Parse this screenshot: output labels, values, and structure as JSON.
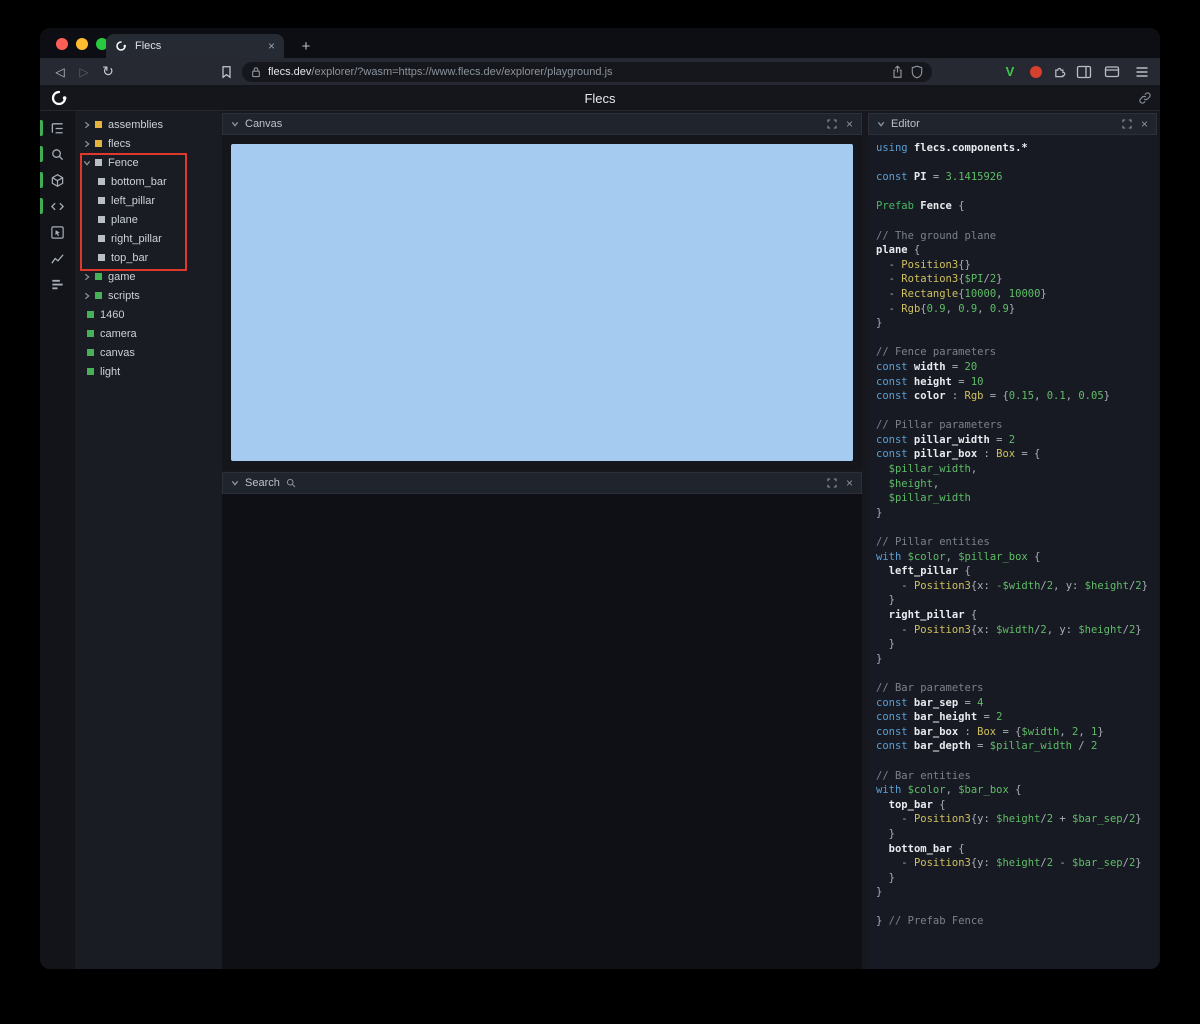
{
  "colors": {
    "canvas_surface": "#a6cbf0",
    "accent_green": "#3fae54",
    "annotation_red": "#e0382c",
    "module_yellow": "#e4b33e",
    "entity_green": "#47b158",
    "prefab_gray": "#b8bfc7",
    "traffic_red": "#ff5f57",
    "traffic_yellow": "#febc2e",
    "traffic_green": "#28c840",
    "code": {
      "keyword": "#5a9fd4",
      "definition": "#45b863",
      "type": "#cfc05e",
      "number": "#5fbd68",
      "variable": "#5fbd68",
      "comment": "#7b818b",
      "identifier": "#e8ebef",
      "plain": "#a9afb8"
    }
  },
  "glyphs": {
    "close": "×",
    "plus": "+",
    "back": "◁",
    "forward": "▷",
    "reload": "↻",
    "v_badge": "V"
  },
  "browser": {
    "tab_title": "Flecs",
    "url_domain": "flecs.dev",
    "url_rest": "/explorer/?wasm=https://www.flecs.dev/explorer/playground.js"
  },
  "header": {
    "title": "Flecs"
  },
  "rail": {
    "icons": [
      {
        "name": "entity-tree-icon",
        "active": true
      },
      {
        "name": "query-search-icon",
        "active": true
      },
      {
        "name": "scene-cube-icon",
        "active": true
      },
      {
        "name": "code-editor-icon",
        "active": true
      },
      {
        "name": "inspector-cursor-icon",
        "active": false
      },
      {
        "name": "stats-chart-icon",
        "active": false
      },
      {
        "name": "metrics-bars-icon",
        "active": false
      }
    ]
  },
  "tree": {
    "items": [
      {
        "label": "assemblies",
        "indent": 0,
        "state": "collapsed",
        "square": "yellow"
      },
      {
        "label": "flecs",
        "indent": 0,
        "state": "collapsed",
        "square": "yellow"
      },
      {
        "label": "Fence",
        "indent": 0,
        "state": "expanded",
        "square": "gray"
      },
      {
        "label": "bottom_bar",
        "indent": 1,
        "state": "leaf",
        "square": "gray"
      },
      {
        "label": "left_pillar",
        "indent": 1,
        "state": "leaf",
        "square": "gray"
      },
      {
        "label": "plane",
        "indent": 1,
        "state": "leaf",
        "square": "gray"
      },
      {
        "label": "right_pillar",
        "indent": 1,
        "state": "leaf",
        "square": "gray"
      },
      {
        "label": "top_bar",
        "indent": 1,
        "state": "leaf",
        "square": "gray"
      },
      {
        "label": "game",
        "indent": 0,
        "state": "collapsed",
        "square": "green"
      },
      {
        "label": "scripts",
        "indent": 0,
        "state": "collapsed",
        "square": "green"
      },
      {
        "label": "1460",
        "indent": 0,
        "state": "leaf",
        "square": "green"
      },
      {
        "label": "camera",
        "indent": 0,
        "state": "leaf",
        "square": "green"
      },
      {
        "label": "canvas",
        "indent": 0,
        "state": "leaf",
        "square": "green"
      },
      {
        "label": "light",
        "indent": 0,
        "state": "leaf",
        "square": "green"
      }
    ]
  },
  "panels": {
    "canvas": {
      "title": "Canvas"
    },
    "search": {
      "title": "Search"
    },
    "editor": {
      "title": "Editor"
    }
  },
  "editor": {
    "code_lines": [
      [
        {
          "t": "kw",
          "s": "using"
        },
        {
          "t": "id",
          "s": " flecs.components.*"
        }
      ],
      [],
      [
        {
          "t": "kw",
          "s": "const"
        },
        {
          "t": "id",
          "s": " PI"
        },
        {
          "t": "pl",
          "s": " = "
        },
        {
          "t": "num",
          "s": "3.1415926"
        }
      ],
      [],
      [
        {
          "t": "def",
          "s": "Prefab"
        },
        {
          "t": "id",
          "s": " Fence"
        },
        {
          "t": "pl",
          "s": " {"
        }
      ],
      [],
      [
        {
          "t": "cm",
          "s": "// The ground plane"
        }
      ],
      [
        {
          "t": "id",
          "s": "plane"
        },
        {
          "t": "pl",
          "s": " {"
        }
      ],
      [
        {
          "t": "pl",
          "s": "  - "
        },
        {
          "t": "ty",
          "s": "Position3"
        },
        {
          "t": "pl",
          "s": "{}"
        }
      ],
      [
        {
          "t": "pl",
          "s": "  - "
        },
        {
          "t": "ty",
          "s": "Rotation3"
        },
        {
          "t": "pl",
          "s": "{"
        },
        {
          "t": "var",
          "s": "$PI"
        },
        {
          "t": "pl",
          "s": "/"
        },
        {
          "t": "num",
          "s": "2"
        },
        {
          "t": "pl",
          "s": "}"
        }
      ],
      [
        {
          "t": "pl",
          "s": "  - "
        },
        {
          "t": "ty",
          "s": "Rectangle"
        },
        {
          "t": "pl",
          "s": "{"
        },
        {
          "t": "num",
          "s": "10000"
        },
        {
          "t": "pl",
          "s": ", "
        },
        {
          "t": "num",
          "s": "10000"
        },
        {
          "t": "pl",
          "s": "}"
        }
      ],
      [
        {
          "t": "pl",
          "s": "  - "
        },
        {
          "t": "ty",
          "s": "Rgb"
        },
        {
          "t": "pl",
          "s": "{"
        },
        {
          "t": "num",
          "s": "0.9"
        },
        {
          "t": "pl",
          "s": ", "
        },
        {
          "t": "num",
          "s": "0.9"
        },
        {
          "t": "pl",
          "s": ", "
        },
        {
          "t": "num",
          "s": "0.9"
        },
        {
          "t": "pl",
          "s": "}"
        }
      ],
      [
        {
          "t": "pl",
          "s": "}"
        }
      ],
      [],
      [
        {
          "t": "cm",
          "s": "// Fence parameters"
        }
      ],
      [
        {
          "t": "kw",
          "s": "const"
        },
        {
          "t": "id",
          "s": " width"
        },
        {
          "t": "pl",
          "s": " = "
        },
        {
          "t": "num",
          "s": "20"
        }
      ],
      [
        {
          "t": "kw",
          "s": "const"
        },
        {
          "t": "id",
          "s": " height"
        },
        {
          "t": "pl",
          "s": " = "
        },
        {
          "t": "num",
          "s": "10"
        }
      ],
      [
        {
          "t": "kw",
          "s": "const"
        },
        {
          "t": "id",
          "s": " color"
        },
        {
          "t": "pl",
          "s": " : "
        },
        {
          "t": "ty",
          "s": "Rgb"
        },
        {
          "t": "pl",
          "s": " = {"
        },
        {
          "t": "num",
          "s": "0.15"
        },
        {
          "t": "pl",
          "s": ", "
        },
        {
          "t": "num",
          "s": "0.1"
        },
        {
          "t": "pl",
          "s": ", "
        },
        {
          "t": "num",
          "s": "0.05"
        },
        {
          "t": "pl",
          "s": "}"
        }
      ],
      [],
      [
        {
          "t": "cm",
          "s": "// Pillar parameters"
        }
      ],
      [
        {
          "t": "kw",
          "s": "const"
        },
        {
          "t": "id",
          "s": " pillar_width"
        },
        {
          "t": "pl",
          "s": " = "
        },
        {
          "t": "num",
          "s": "2"
        }
      ],
      [
        {
          "t": "kw",
          "s": "const"
        },
        {
          "t": "id",
          "s": " pillar_box"
        },
        {
          "t": "pl",
          "s": " : "
        },
        {
          "t": "ty",
          "s": "Box"
        },
        {
          "t": "pl",
          "s": " = {"
        }
      ],
      [
        {
          "t": "pl",
          "s": "  "
        },
        {
          "t": "var",
          "s": "$pillar_width"
        },
        {
          "t": "pl",
          "s": ","
        }
      ],
      [
        {
          "t": "pl",
          "s": "  "
        },
        {
          "t": "var",
          "s": "$height"
        },
        {
          "t": "pl",
          "s": ","
        }
      ],
      [
        {
          "t": "pl",
          "s": "  "
        },
        {
          "t": "var",
          "s": "$pillar_width"
        }
      ],
      [
        {
          "t": "pl",
          "s": "}"
        }
      ],
      [],
      [
        {
          "t": "cm",
          "s": "// Pillar entities"
        }
      ],
      [
        {
          "t": "kw",
          "s": "with"
        },
        {
          "t": "pl",
          "s": " "
        },
        {
          "t": "var",
          "s": "$color"
        },
        {
          "t": "pl",
          "s": ", "
        },
        {
          "t": "var",
          "s": "$pillar_box"
        },
        {
          "t": "pl",
          "s": " {"
        }
      ],
      [
        {
          "t": "pl",
          "s": "  "
        },
        {
          "t": "id",
          "s": "left_pillar"
        },
        {
          "t": "pl",
          "s": " {"
        }
      ],
      [
        {
          "t": "pl",
          "s": "    - "
        },
        {
          "t": "ty",
          "s": "Position3"
        },
        {
          "t": "pl",
          "s": "{x: "
        },
        {
          "t": "var",
          "s": "-$width"
        },
        {
          "t": "pl",
          "s": "/"
        },
        {
          "t": "num",
          "s": "2"
        },
        {
          "t": "pl",
          "s": ", y: "
        },
        {
          "t": "var",
          "s": "$height"
        },
        {
          "t": "pl",
          "s": "/"
        },
        {
          "t": "num",
          "s": "2"
        },
        {
          "t": "pl",
          "s": "}"
        }
      ],
      [
        {
          "t": "pl",
          "s": "  }"
        }
      ],
      [
        {
          "t": "pl",
          "s": "  "
        },
        {
          "t": "id",
          "s": "right_pillar"
        },
        {
          "t": "pl",
          "s": " {"
        }
      ],
      [
        {
          "t": "pl",
          "s": "    - "
        },
        {
          "t": "ty",
          "s": "Position3"
        },
        {
          "t": "pl",
          "s": "{x: "
        },
        {
          "t": "var",
          "s": "$width"
        },
        {
          "t": "pl",
          "s": "/"
        },
        {
          "t": "num",
          "s": "2"
        },
        {
          "t": "pl",
          "s": ", y: "
        },
        {
          "t": "var",
          "s": "$height"
        },
        {
          "t": "pl",
          "s": "/"
        },
        {
          "t": "num",
          "s": "2"
        },
        {
          "t": "pl",
          "s": "}"
        }
      ],
      [
        {
          "t": "pl",
          "s": "  }"
        }
      ],
      [
        {
          "t": "pl",
          "s": "}"
        }
      ],
      [],
      [
        {
          "t": "cm",
          "s": "// Bar parameters"
        }
      ],
      [
        {
          "t": "kw",
          "s": "const"
        },
        {
          "t": "id",
          "s": " bar_sep"
        },
        {
          "t": "pl",
          "s": " = "
        },
        {
          "t": "num",
          "s": "4"
        }
      ],
      [
        {
          "t": "kw",
          "s": "const"
        },
        {
          "t": "id",
          "s": " bar_height"
        },
        {
          "t": "pl",
          "s": " = "
        },
        {
          "t": "num",
          "s": "2"
        }
      ],
      [
        {
          "t": "kw",
          "s": "const"
        },
        {
          "t": "id",
          "s": " bar_box"
        },
        {
          "t": "pl",
          "s": " : "
        },
        {
          "t": "ty",
          "s": "Box"
        },
        {
          "t": "pl",
          "s": " = {"
        },
        {
          "t": "var",
          "s": "$width"
        },
        {
          "t": "pl",
          "s": ", "
        },
        {
          "t": "num",
          "s": "2"
        },
        {
          "t": "pl",
          "s": ", "
        },
        {
          "t": "num",
          "s": "1"
        },
        {
          "t": "pl",
          "s": "}"
        }
      ],
      [
        {
          "t": "kw",
          "s": "const"
        },
        {
          "t": "id",
          "s": " bar_depth"
        },
        {
          "t": "pl",
          "s": " = "
        },
        {
          "t": "var",
          "s": "$pillar_width"
        },
        {
          "t": "pl",
          "s": " / "
        },
        {
          "t": "num",
          "s": "2"
        }
      ],
      [],
      [
        {
          "t": "cm",
          "s": "// Bar entities"
        }
      ],
      [
        {
          "t": "kw",
          "s": "with"
        },
        {
          "t": "pl",
          "s": " "
        },
        {
          "t": "var",
          "s": "$color"
        },
        {
          "t": "pl",
          "s": ", "
        },
        {
          "t": "var",
          "s": "$bar_box"
        },
        {
          "t": "pl",
          "s": " {"
        }
      ],
      [
        {
          "t": "pl",
          "s": "  "
        },
        {
          "t": "id",
          "s": "top_bar"
        },
        {
          "t": "pl",
          "s": " {"
        }
      ],
      [
        {
          "t": "pl",
          "s": "    - "
        },
        {
          "t": "ty",
          "s": "Position3"
        },
        {
          "t": "pl",
          "s": "{y: "
        },
        {
          "t": "var",
          "s": "$height"
        },
        {
          "t": "pl",
          "s": "/"
        },
        {
          "t": "num",
          "s": "2"
        },
        {
          "t": "pl",
          "s": " + "
        },
        {
          "t": "var",
          "s": "$bar_sep"
        },
        {
          "t": "pl",
          "s": "/"
        },
        {
          "t": "num",
          "s": "2"
        },
        {
          "t": "pl",
          "s": "}"
        }
      ],
      [
        {
          "t": "pl",
          "s": "  }"
        }
      ],
      [
        {
          "t": "pl",
          "s": "  "
        },
        {
          "t": "id",
          "s": "bottom_bar"
        },
        {
          "t": "pl",
          "s": " {"
        }
      ],
      [
        {
          "t": "pl",
          "s": "    - "
        },
        {
          "t": "ty",
          "s": "Position3"
        },
        {
          "t": "pl",
          "s": "{y: "
        },
        {
          "t": "var",
          "s": "$height"
        },
        {
          "t": "pl",
          "s": "/"
        },
        {
          "t": "num",
          "s": "2"
        },
        {
          "t": "pl",
          "s": " - "
        },
        {
          "t": "var",
          "s": "$bar_sep"
        },
        {
          "t": "pl",
          "s": "/"
        },
        {
          "t": "num",
          "s": "2"
        },
        {
          "t": "pl",
          "s": "}"
        }
      ],
      [
        {
          "t": "pl",
          "s": "  }"
        }
      ],
      [
        {
          "t": "pl",
          "s": "}"
        }
      ],
      [],
      [
        {
          "t": "pl",
          "s": "} "
        },
        {
          "t": "cm",
          "s": "// Prefab Fence"
        }
      ]
    ]
  }
}
